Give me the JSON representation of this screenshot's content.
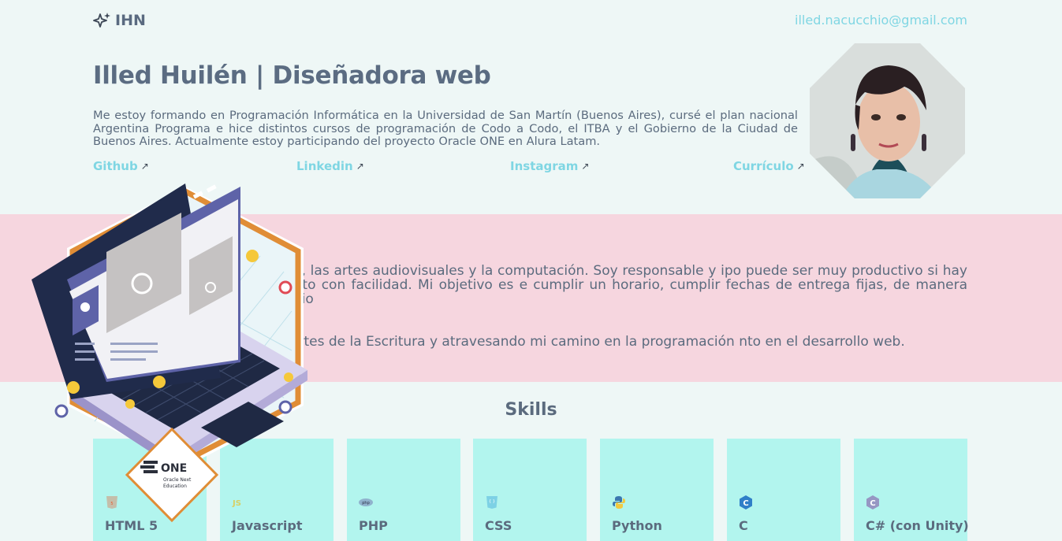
{
  "header": {
    "logo_text": "IHN",
    "logo_icon": "sparkles-icon",
    "email": "illed.nacucchio@gmail.com",
    "title": "Illed Huilén | Diseñadora web",
    "intro": "Me estoy formando en Programación Informática en la Universidad de San Martín (Buenos Aires), cursé el plan nacional Argentina Programa e hice distintos cursos de programación de Codo a Codo, el ITBA y el Gobierno de la Ciudad de Buenos Aires. Actualmente estoy participando del proyecto Oracle ONE en Alura Latam.",
    "links": [
      {
        "label": "Github",
        "icon": "external-arrow-icon"
      },
      {
        "label": "Linkedin",
        "icon": "external-arrow-icon"
      },
      {
        "label": "Instagram",
        "icon": "external-arrow-icon"
      },
      {
        "label": "Currículo",
        "icon": "external-arrow-icon"
      }
    ],
    "arrow_glyph": "↗"
  },
  "about": {
    "paragraph_1": "res influencias son la literatura, las artes audiovisuales y la computación. Soy responsable y ipo puede ser muy productivo si hay buena comunicación. Me adapto con facilidad. Mi objetivo es e cumplir un horario, cumplir fechas de entrega fijas, de manera que pueda administrar mi propio",
    "paragraph_2": "la tesis de la Licenciatura en Artes de la Escritura y atravesando mi camino en la programación nto en el desarrollo web."
  },
  "badge": {
    "title": "ONE",
    "subtitle_line1": "Oracle Next",
    "subtitle_line2": "Education"
  },
  "skills": {
    "title": "Skills",
    "items": [
      {
        "name": "HTML 5",
        "icon": "html5-icon",
        "color": "#e65a2c"
      },
      {
        "name": "Javascript",
        "icon": "javascript-icon",
        "color": "#e8d44d"
      },
      {
        "name": "PHP",
        "icon": "php-icon",
        "color": "#7a86b8"
      },
      {
        "name": "CSS",
        "icon": "css3-icon",
        "color": "#2d9bd8"
      },
      {
        "name": "Python",
        "icon": "python-icon",
        "color": "#3b78b0"
      },
      {
        "name": "C",
        "icon": "c-language-icon",
        "color": "#2f7fc8"
      },
      {
        "name": "C# (con Unity)",
        "icon": "csharp-icon",
        "color": "#8a6fb0"
      }
    ]
  },
  "colors": {
    "accent": "#7fd6e3",
    "text": "#5b6b7e",
    "background": "#eef7f6",
    "about_background": "#f6d6df",
    "skill_card": "#b2f5ee"
  }
}
